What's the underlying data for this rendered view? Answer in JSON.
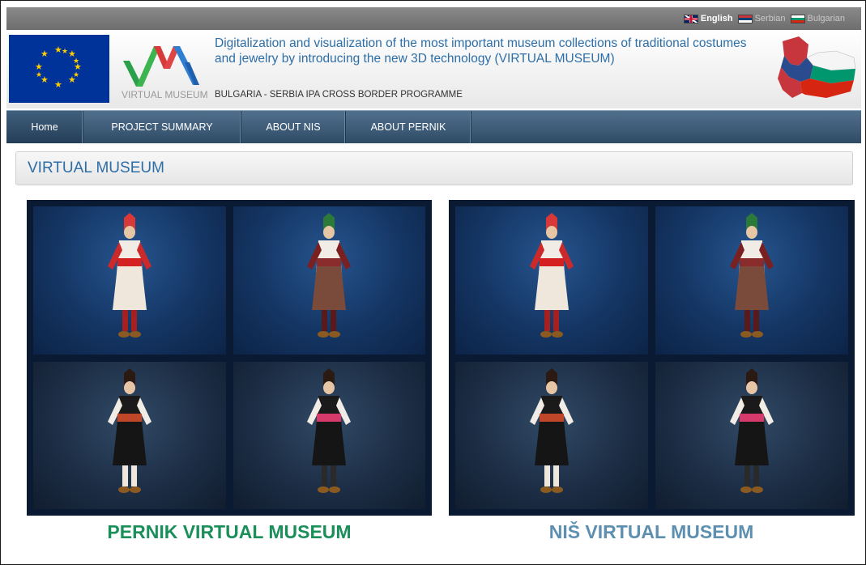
{
  "languages": [
    {
      "label": "English",
      "flag": "uk-flag-icon",
      "active": true
    },
    {
      "label": "Serbian",
      "flag": "serbia-flag-icon",
      "active": false
    },
    {
      "label": "Bulgarian",
      "flag": "bulgaria-flag-icon",
      "active": false
    }
  ],
  "header": {
    "logo_text": "VIRTUAL MUSEUM",
    "title": "Digitalization and visualization of the most important museum collections of traditional costumes and jewelry by introducing the new 3D technology (VIRTUAL MUSEUM)",
    "subtitle": "BULGARIA - SERBIA IPA CROSS BORDER PROGRAMME"
  },
  "nav": [
    {
      "label": "Home"
    },
    {
      "label": "PROJECT SUMMARY"
    },
    {
      "label": "ABOUT NIS"
    },
    {
      "label": "ABOUT PERNIK"
    }
  ],
  "section_title": "VIRTUAL MUSEUM",
  "museums": [
    {
      "caption": "PERNIK VIRTUAL MUSEUM",
      "color": "#1a8f5a"
    },
    {
      "caption": "NIŠ VIRTUAL MUSEUM",
      "color": "#5d8fb0"
    }
  ],
  "colors": {
    "accent": "#2e6ea6",
    "nav": "#3a5a78"
  }
}
